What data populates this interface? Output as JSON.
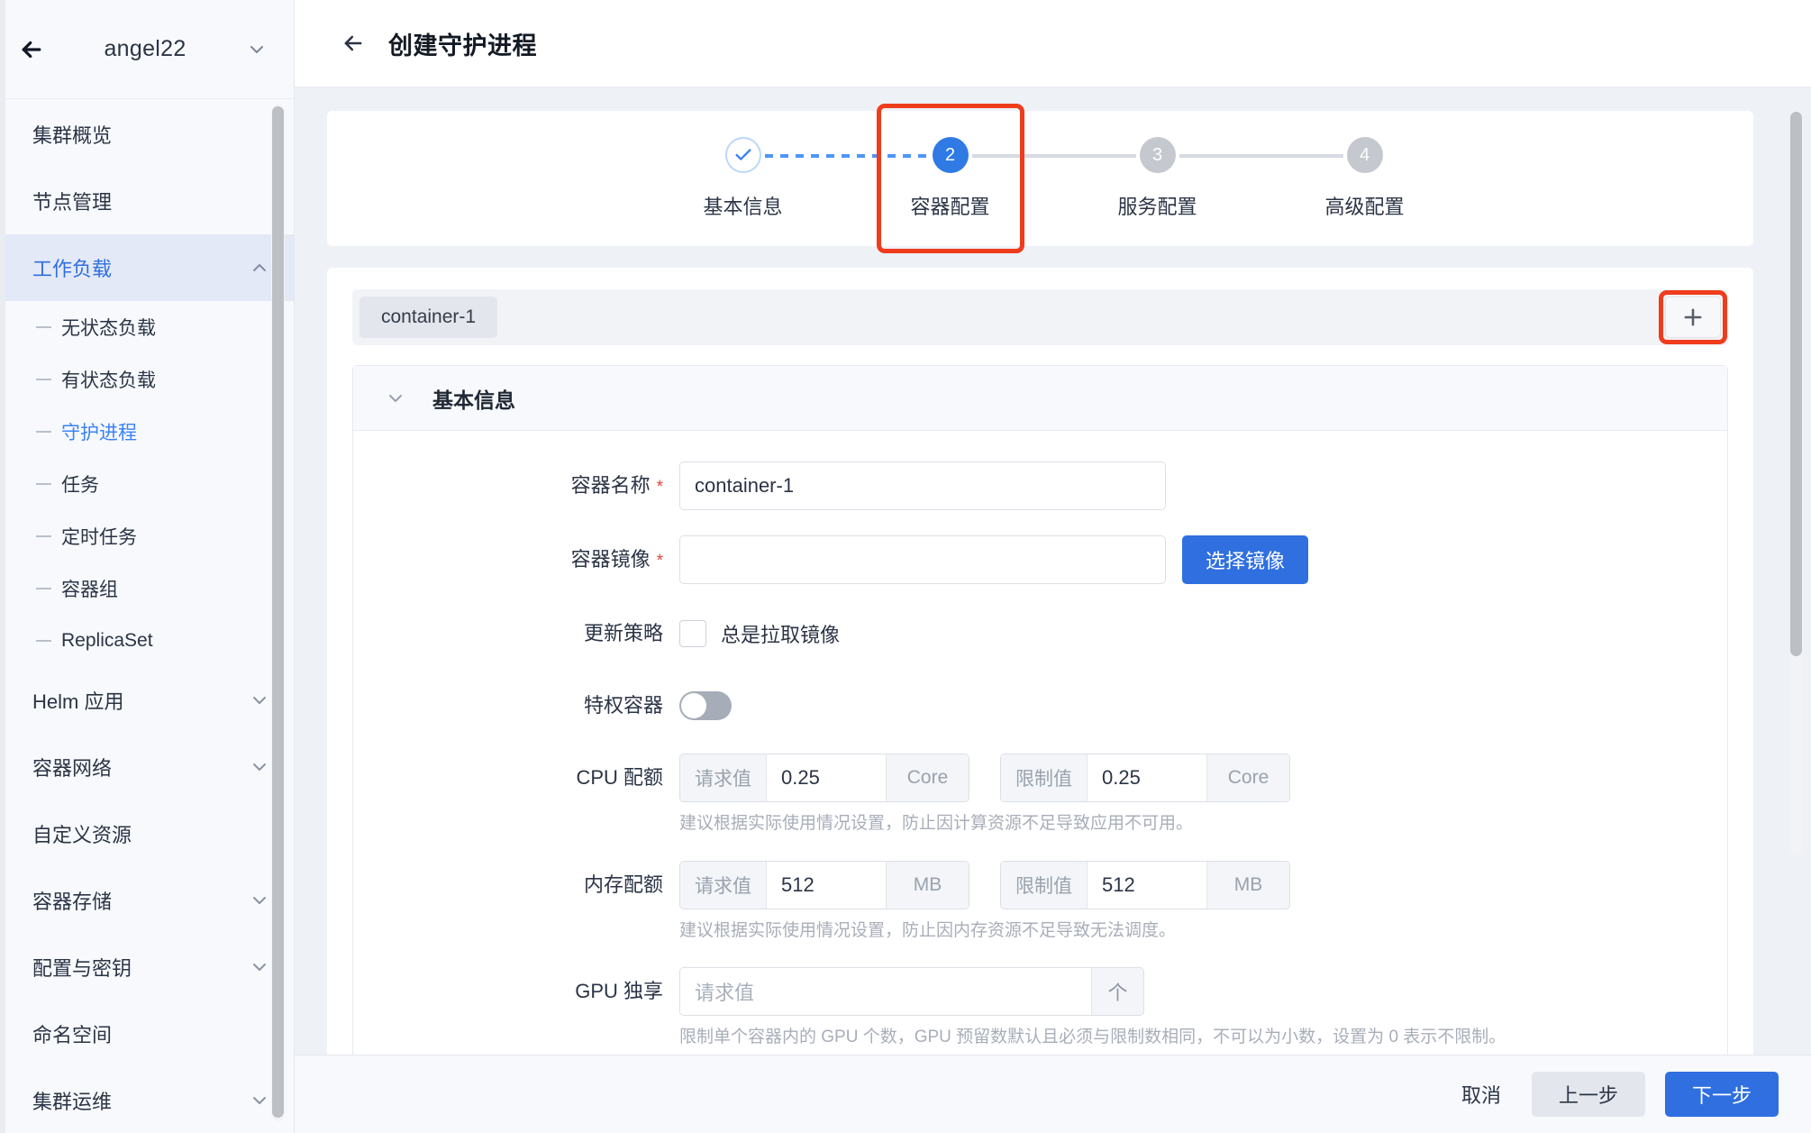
{
  "sidebar": {
    "cluster_name": "angel22",
    "back_icon": "arrow-left-icon",
    "caret_icon": "chevron-down-icon",
    "items": [
      {
        "label": "集群概览",
        "type": "item",
        "state": "normal"
      },
      {
        "label": "节点管理",
        "type": "item",
        "state": "normal"
      },
      {
        "label": "工作负载",
        "type": "group",
        "state": "active",
        "caret": "chevron-up-icon"
      },
      {
        "label": "无状态负载",
        "type": "sub",
        "state": "normal"
      },
      {
        "label": "有状态负载",
        "type": "sub",
        "state": "normal"
      },
      {
        "label": "守护进程",
        "type": "sub",
        "state": "selected"
      },
      {
        "label": "任务",
        "type": "sub",
        "state": "normal"
      },
      {
        "label": "定时任务",
        "type": "sub",
        "state": "normal"
      },
      {
        "label": "容器组",
        "type": "sub",
        "state": "normal"
      },
      {
        "label": "ReplicaSet",
        "type": "sub",
        "state": "normal"
      },
      {
        "label": "Helm 应用",
        "type": "group",
        "state": "normal",
        "caret": "chevron-down-icon"
      },
      {
        "label": "容器网络",
        "type": "group",
        "state": "normal",
        "caret": "chevron-down-icon"
      },
      {
        "label": "自定义资源",
        "type": "item",
        "state": "normal"
      },
      {
        "label": "容器存储",
        "type": "group",
        "state": "normal",
        "caret": "chevron-down-icon"
      },
      {
        "label": "配置与密钥",
        "type": "group",
        "state": "normal",
        "caret": "chevron-down-icon"
      },
      {
        "label": "命名空间",
        "type": "item",
        "state": "normal"
      },
      {
        "label": "集群运维",
        "type": "group",
        "state": "normal",
        "caret": "chevron-down-icon"
      }
    ]
  },
  "topbar": {
    "back_icon": "arrow-left-icon",
    "title": "创建守护进程"
  },
  "stepper": {
    "highlight_color": "#ef3c1d",
    "steps": [
      {
        "num": "✓",
        "label": "基本信息",
        "state": "done"
      },
      {
        "num": "2",
        "label": "容器配置",
        "state": "current",
        "highlighted": true
      },
      {
        "num": "3",
        "label": "服务配置",
        "state": "pending"
      },
      {
        "num": "4",
        "label": "高级配置",
        "state": "pending"
      }
    ]
  },
  "container": {
    "tabs": [
      {
        "label": "container-1",
        "active": true
      }
    ],
    "add_button": {
      "icon": "plus-icon",
      "highlighted": true
    },
    "panel": {
      "title": "基本信息",
      "chevron": "chevron-down-icon",
      "fields": {
        "name": {
          "label": "容器名称",
          "required": true,
          "value": "container-1",
          "placeholder": ""
        },
        "image": {
          "label": "容器镜像",
          "required": true,
          "value": "",
          "placeholder": "",
          "button_label": "选择镜像"
        },
        "update_policy": {
          "label": "更新策略",
          "checkbox_label": "总是拉取镜像",
          "checked": false
        },
        "privileged": {
          "label": "特权容器",
          "on": false
        },
        "cpu": {
          "label": "CPU 配额",
          "request_prefix": "请求值",
          "request_value": "0.25",
          "request_unit": "Core",
          "limit_prefix": "限制值",
          "limit_value": "0.25",
          "limit_unit": "Core",
          "hint": "建议根据实际使用情况设置，防止因计算资源不足导致应用不可用。"
        },
        "memory": {
          "label": "内存配额",
          "request_prefix": "请求值",
          "request_value": "512",
          "request_unit": "MB",
          "limit_prefix": "限制值",
          "limit_value": "512",
          "limit_unit": "MB",
          "hint": "建议根据实际使用情况设置，防止因内存资源不足导致无法调度。"
        },
        "gpu": {
          "label": "GPU 独享",
          "placeholder": "请求值",
          "value": "",
          "unit": "个",
          "hint": "限制单个容器内的 GPU 个数，GPU 预留数默认且必须与限制数相同，不可以为小数，设置为 0 表示不限制。"
        }
      }
    }
  },
  "footer": {
    "cancel": "取消",
    "prev": "上一步",
    "next": "下一步"
  },
  "colors": {
    "primary": "#2f6fe0",
    "highlight": "#ef3c1d",
    "link": "#3b82f6",
    "required": "#e8453c"
  }
}
